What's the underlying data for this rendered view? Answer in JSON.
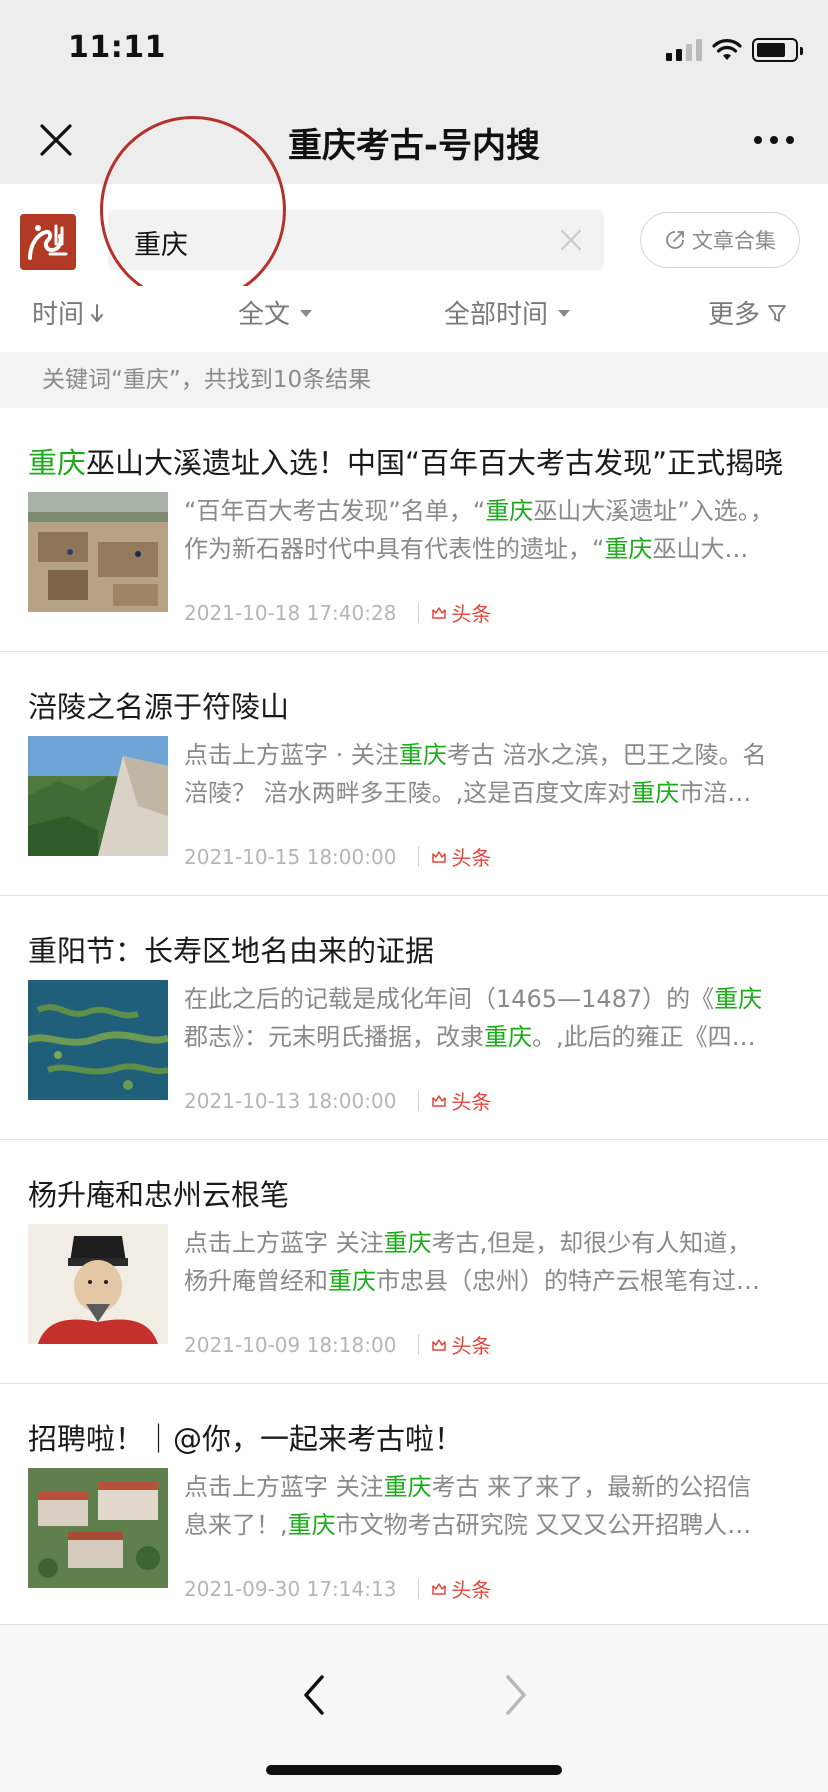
{
  "status_bar": {
    "time": "11:11"
  },
  "nav": {
    "title": "重庆考古-号内搜"
  },
  "search": {
    "value": "重庆",
    "collection_button": "文章合集"
  },
  "filters": {
    "sort": "时间",
    "scope": "全文",
    "range": "全部时间",
    "more": "更多"
  },
  "result_summary": "关键词“重庆”，共找到10条结果",
  "articles": [
    {
      "title": [
        {
          "t": "重庆",
          "h": true
        },
        {
          "t": "巫山大溪遗址入选！中国“百年百大考古发现”正式揭晓",
          "h": false
        }
      ],
      "snippet1": [
        {
          "t": "“百年百大考古发现”名单，“",
          "h": false
        },
        {
          "t": "重庆",
          "h": true
        },
        {
          "t": "巫山大溪遗址”入选。，",
          "h": false
        }
      ],
      "snippet2": [
        {
          "t": "作为新石器时代中具有代表性的遗址，“",
          "h": false
        },
        {
          "t": "重庆",
          "h": true
        },
        {
          "t": "巫山大…",
          "h": false
        }
      ],
      "date": "2021-10-18 17:40:28",
      "tag": "头条",
      "thumb": "excavation"
    },
    {
      "title": [
        {
          "t": "涪陵之名源于符陵山",
          "h": false
        }
      ],
      "snippet1": [
        {
          "t": "点击上方蓝字 · 关注",
          "h": false
        },
        {
          "t": "重庆",
          "h": true
        },
        {
          "t": "考古 涪水之滨，巴王之陵。名",
          "h": false
        }
      ],
      "snippet2": [
        {
          "t": "涪陵？ 涪水两畔多王陵。,这是百度文库对",
          "h": false
        },
        {
          "t": "重庆",
          "h": true
        },
        {
          "t": "市涪…",
          "h": false
        }
      ],
      "date": "2021-10-15 18:00:00",
      "tag": "头条",
      "thumb": "mountain"
    },
    {
      "title": [
        {
          "t": "重阳节：长寿区地名由来的证据",
          "h": false
        }
      ],
      "snippet1": [
        {
          "t": "在此之后的记载是成化年间（1465—1487）的《",
          "h": false
        },
        {
          "t": "重庆",
          "h": true
        }
      ],
      "snippet2": [
        {
          "t": "郡志》：元末明氏播据，改隶",
          "h": false
        },
        {
          "t": "重庆",
          "h": true
        },
        {
          "t": "。,此后的雍正《四…",
          "h": false
        }
      ],
      "date": "2021-10-13 18:00:00",
      "tag": "头条",
      "thumb": "lake"
    },
    {
      "title": [
        {
          "t": "杨升庵和忠州云根笔",
          "h": false
        }
      ],
      "snippet1": [
        {
          "t": "点击上方蓝字 关注",
          "h": false
        },
        {
          "t": "重庆",
          "h": true
        },
        {
          "t": "考古,但是，却很少有人知道，",
          "h": false
        }
      ],
      "snippet2": [
        {
          "t": "杨升庵曾经和",
          "h": false
        },
        {
          "t": "重庆",
          "h": true
        },
        {
          "t": "市忠县（忠州）的特产云根笔有过…",
          "h": false
        }
      ],
      "date": "2021-10-09 18:18:00",
      "tag": "头条",
      "thumb": "portrait"
    },
    {
      "title": [
        {
          "t": "招聘啦！｜@你，一起来考古啦！",
          "h": false
        }
      ],
      "snippet1": [
        {
          "t": "点击上方蓝字 关注",
          "h": false
        },
        {
          "t": "重庆",
          "h": true
        },
        {
          "t": "考古 来了来了，最新的公招信",
          "h": false
        }
      ],
      "snippet2": [
        {
          "t": "息来了！,",
          "h": false
        },
        {
          "t": "重庆",
          "h": true
        },
        {
          "t": "市文物考古研究院 又又又公开招聘人…",
          "h": false
        }
      ],
      "date": "2021-09-30 17:14:13",
      "tag": "头条",
      "thumb": "campus"
    }
  ]
}
